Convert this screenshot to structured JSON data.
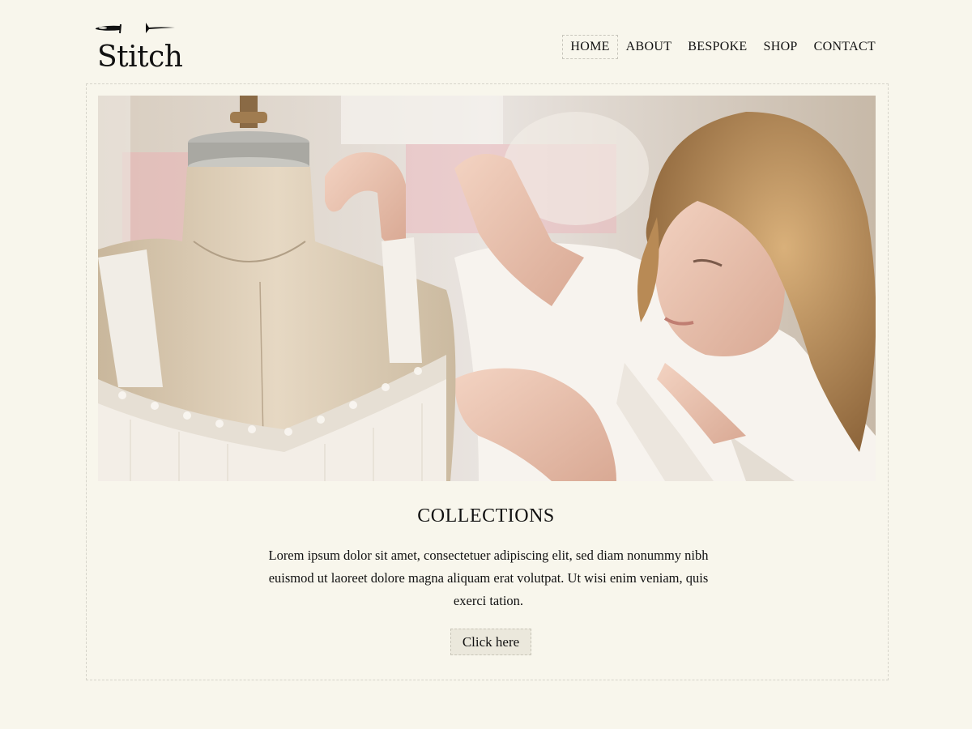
{
  "brand": {
    "name": "Stitch",
    "logo_icon": "needle-icon"
  },
  "nav": {
    "items": [
      {
        "label": "HOME",
        "active": true
      },
      {
        "label": "ABOUT",
        "active": false
      },
      {
        "label": "BESPOKE",
        "active": false
      },
      {
        "label": "SHOP",
        "active": false
      },
      {
        "label": "CONTACT",
        "active": false
      }
    ]
  },
  "hero": {
    "image": "tailor-with-dress-form-photo"
  },
  "section": {
    "title": "COLLECTIONS",
    "body": "Lorem ipsum dolor sit amet, consectetuer adipiscing elit, sed diam nonummy nibh euismod ut laoreet dolore magna aliquam erat volutpat. Ut wisi enim veniam, quis exerci tation.",
    "button_label": "Click here"
  },
  "colors": {
    "background": "#f8f6ec",
    "button_bg": "#ebe8dc",
    "border": "#d6d4ca",
    "text": "#111111"
  }
}
